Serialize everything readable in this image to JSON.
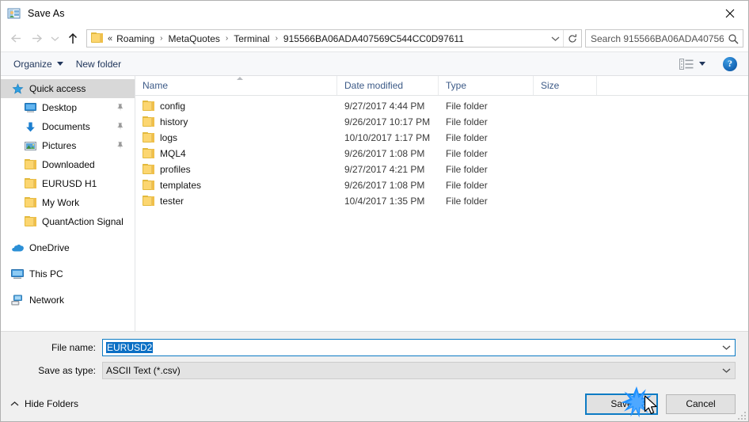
{
  "window": {
    "title": "Save As",
    "app_icon": "photo-person-icon",
    "close_label": "✕"
  },
  "nav": {
    "back_icon": "arrow-left-icon",
    "forward_icon": "arrow-right-icon",
    "recent_icon": "chevron-down-icon",
    "up_icon": "arrow-up-icon",
    "breadcrumb_prefix": "«",
    "breadcrumbs": [
      "Roaming",
      "MetaQuotes",
      "Terminal",
      "915566BA06ADA407569C544CC0D97611"
    ],
    "separator": "›",
    "dropdown_icon": "chevron-down-icon",
    "refresh_icon": "refresh-icon"
  },
  "search": {
    "placeholder": "Search 915566BA06ADA40756...",
    "icon": "search-icon"
  },
  "toolbar": {
    "organize_label": "Organize",
    "new_folder_label": "New folder",
    "view_icon": "list-view-icon",
    "view_caret_icon": "caret-down-icon",
    "help_label": "?"
  },
  "sidebar": {
    "items": [
      {
        "label": "Quick access",
        "icon": "star-icon",
        "selected": true,
        "indent": false,
        "pinned": false,
        "group": false
      },
      {
        "label": "Desktop",
        "icon": "monitor-icon",
        "selected": false,
        "indent": true,
        "pinned": true,
        "group": false
      },
      {
        "label": "Documents",
        "icon": "download-arrow-icon",
        "selected": false,
        "indent": true,
        "pinned": true,
        "group": false
      },
      {
        "label": "Pictures",
        "icon": "picture-icon",
        "selected": false,
        "indent": true,
        "pinned": true,
        "group": false
      },
      {
        "label": "Downloaded",
        "icon": "folder-icon",
        "selected": false,
        "indent": true,
        "pinned": false,
        "group": false
      },
      {
        "label": "EURUSD H1",
        "icon": "folder-icon",
        "selected": false,
        "indent": true,
        "pinned": false,
        "group": false
      },
      {
        "label": "My Work",
        "icon": "folder-icon",
        "selected": false,
        "indent": true,
        "pinned": false,
        "group": false
      },
      {
        "label": "QuantAction Signal",
        "icon": "folder-icon",
        "selected": false,
        "indent": true,
        "pinned": false,
        "group": false
      },
      {
        "label": "OneDrive",
        "icon": "cloud-icon",
        "selected": false,
        "indent": false,
        "pinned": false,
        "group": true
      },
      {
        "label": "This PC",
        "icon": "computer-icon",
        "selected": false,
        "indent": false,
        "pinned": false,
        "group": true
      },
      {
        "label": "Network",
        "icon": "network-icon",
        "selected": false,
        "indent": false,
        "pinned": false,
        "group": true
      }
    ]
  },
  "filelist": {
    "columns": [
      "Name",
      "Date modified",
      "Type",
      "Size"
    ],
    "sort_column": "Name",
    "sort_direction": "ascending",
    "rows": [
      {
        "name": "config",
        "date": "9/27/2017 4:44 PM",
        "type": "File folder",
        "size": ""
      },
      {
        "name": "history",
        "date": "9/26/2017 10:17 PM",
        "type": "File folder",
        "size": ""
      },
      {
        "name": "logs",
        "date": "10/10/2017 1:17 PM",
        "type": "File folder",
        "size": ""
      },
      {
        "name": "MQL4",
        "date": "9/26/2017 1:08 PM",
        "type": "File folder",
        "size": ""
      },
      {
        "name": "profiles",
        "date": "9/27/2017 4:21 PM",
        "type": "File folder",
        "size": ""
      },
      {
        "name": "templates",
        "date": "9/26/2017 1:08 PM",
        "type": "File folder",
        "size": ""
      },
      {
        "name": "tester",
        "date": "10/4/2017 1:35 PM",
        "type": "File folder",
        "size": ""
      }
    ]
  },
  "form": {
    "filename_label": "File name:",
    "filename_value": "EURUSD2",
    "filename_selected": true,
    "savetype_label": "Save as type:",
    "savetype_value": "ASCII Text (*.csv)"
  },
  "footer": {
    "hide_folders_label": "Hide Folders",
    "hide_folders_icon": "chevron-up-icon",
    "save_label": "Save",
    "cancel_label": "Cancel",
    "save_focused": true,
    "click_indicator": "click-burst",
    "cursor": "arrow-cursor"
  },
  "colors": {
    "accent_blue": "#0d7bc4",
    "burst_blue": "#1e90ff",
    "selection_blue": "#0b6fc4",
    "sidebar_selected": "#d8d8d8",
    "folder_yellow": "#fcd670",
    "header_text": "#3c5a87",
    "toolbar_bg": "#f7f8fa",
    "form_bg": "#f0f0f0"
  }
}
